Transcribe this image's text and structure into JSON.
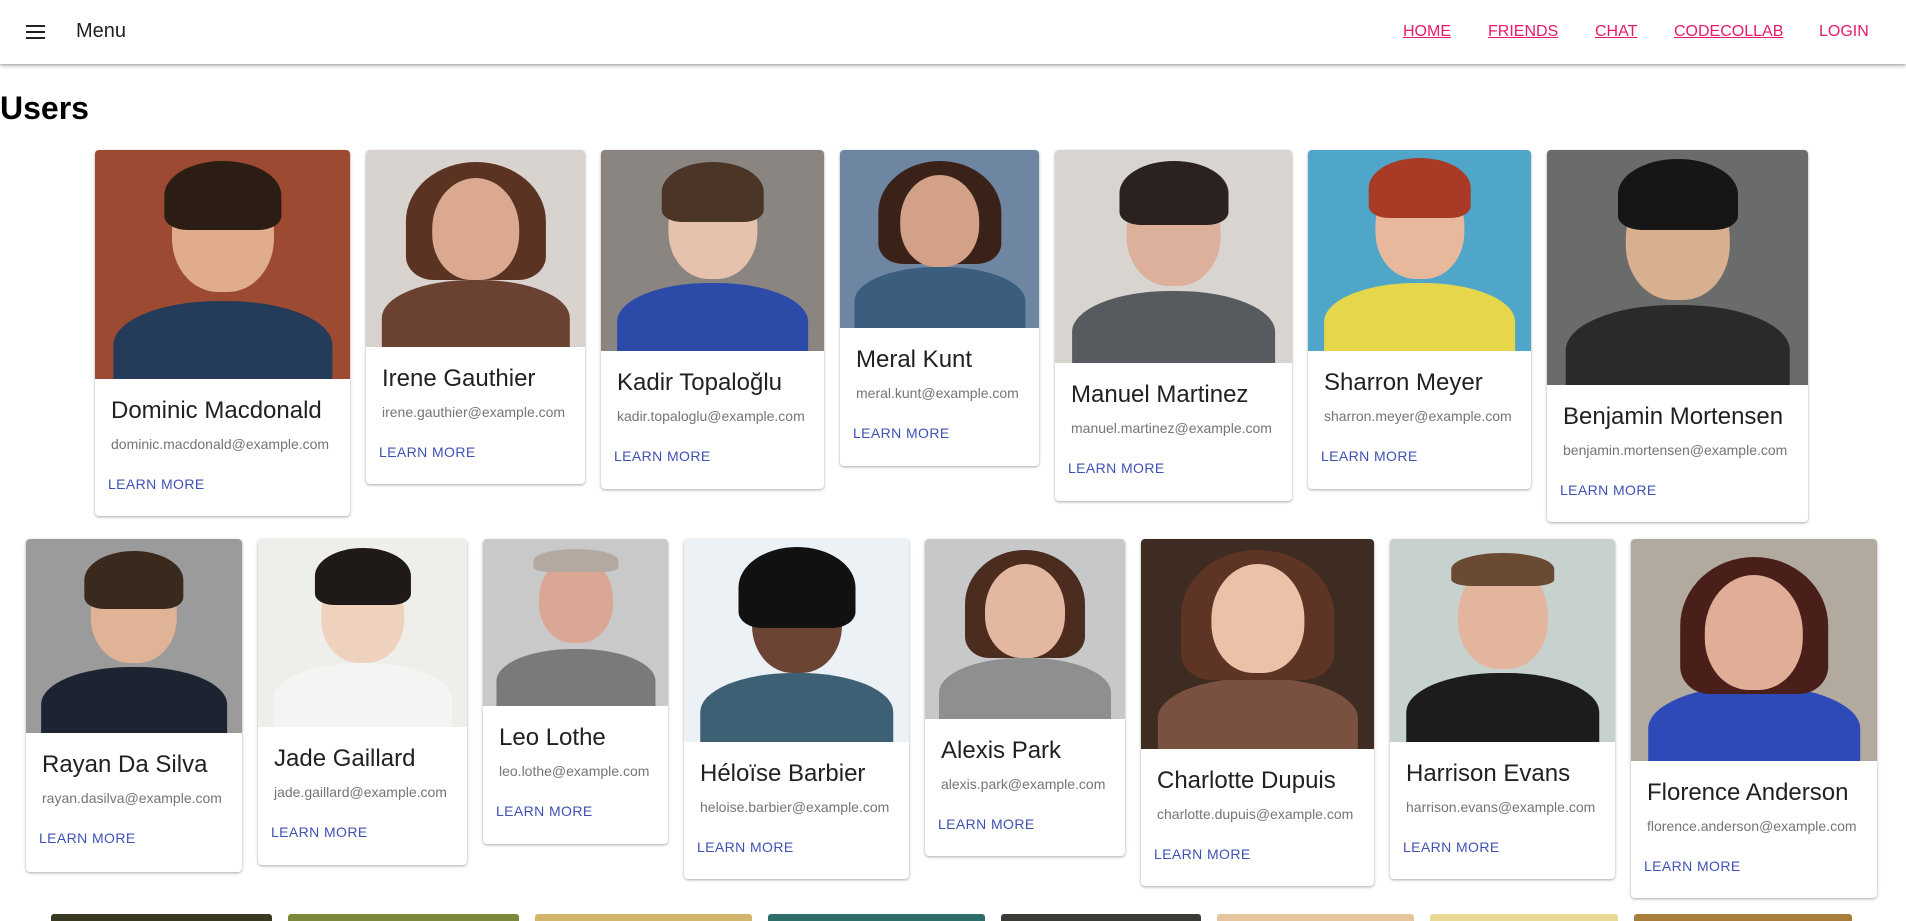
{
  "menu": {
    "label": "Menu"
  },
  "nav": {
    "home": "HOME",
    "friends": "FRIENDS",
    "chat": "CHAT",
    "codecollab": "CODECOLLAB",
    "login": "LOGIN"
  },
  "colors": {
    "nav_link": "#e8196d",
    "learn_more": "#3f51b5",
    "name": "#212121",
    "email": "#757575"
  },
  "page": {
    "title": "Users"
  },
  "users": [
    {
      "name": "Dominic Macdonald",
      "email": "dominic.macdonald@example.com",
      "cta": "LEARN MORE"
    },
    {
      "name": "Irene Gauthier",
      "email": "irene.gauthier@example.com",
      "cta": "LEARN MORE"
    },
    {
      "name": "Kadir Topaloğlu",
      "email": "kadir.topaloglu@example.com",
      "cta": "LEARN MORE"
    },
    {
      "name": "Meral Kunt",
      "email": "meral.kunt@example.com",
      "cta": "LEARN MORE"
    },
    {
      "name": "Manuel Martinez",
      "email": "manuel.martinez@example.com",
      "cta": "LEARN MORE"
    },
    {
      "name": "Sharron Meyer",
      "email": "sharron.meyer@example.com",
      "cta": "LEARN MORE"
    },
    {
      "name": "Benjamin Mortensen",
      "email": "benjamin.mortensen@example.com",
      "cta": "LEARN MORE"
    },
    {
      "name": "Rayan Da Silva",
      "email": "rayan.dasilva@example.com",
      "cta": "LEARN MORE"
    },
    {
      "name": "Jade Gaillard",
      "email": "jade.gaillard@example.com",
      "cta": "LEARN MORE"
    },
    {
      "name": "Leo Lothe",
      "email": "leo.lothe@example.com",
      "cta": "LEARN MORE"
    },
    {
      "name": "Héloïse Barbier",
      "email": "heloise.barbier@example.com",
      "cta": "LEARN MORE"
    },
    {
      "name": "Alexis Park",
      "email": "alexis.park@example.com",
      "cta": "LEARN MORE"
    },
    {
      "name": "Charlotte Dupuis",
      "email": "charlotte.dupuis@example.com",
      "cta": "LEARN MORE"
    },
    {
      "name": "Harrison Evans",
      "email": "harrison.evans@example.com",
      "cta": "LEARN MORE"
    },
    {
      "name": "Florence Anderson",
      "email": "florence.anderson@example.com",
      "cta": "LEARN MORE"
    }
  ]
}
